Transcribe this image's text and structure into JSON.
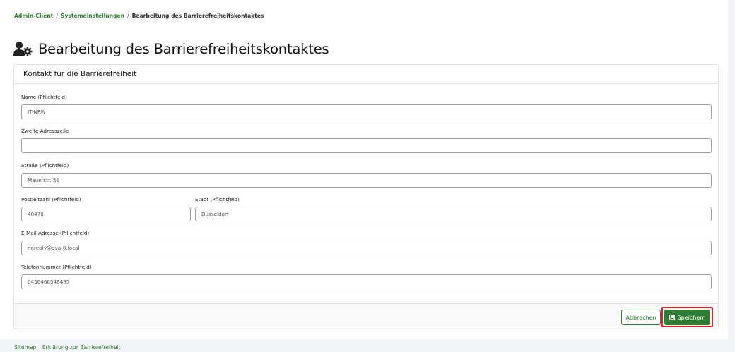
{
  "breadcrumb": {
    "items": [
      "Admin-Client",
      "Systemeinstellungen"
    ],
    "separator": "/",
    "current": "Bearbeitung des Barrierefreiheitskontaktes"
  },
  "page": {
    "title": "Bearbeitung des Barrierefreiheitskontaktes",
    "title_icon": "users-gear-icon"
  },
  "card": {
    "header": "Kontakt für die Barrierefreiheit"
  },
  "form": {
    "name": {
      "label": "Name (Pflichtfeld)",
      "value": "IT-NRW"
    },
    "address2": {
      "label": "Zweite Adresszeile",
      "value": ""
    },
    "street": {
      "label": "Straße (Pflichtfeld)",
      "value": "Mauerstr. 51"
    },
    "postal": {
      "label": "Postleitzahl (Pflichtfeld)",
      "value": "40476"
    },
    "city": {
      "label": "Stadt (Pflichtfeld)",
      "value": "Düsseldorf"
    },
    "email": {
      "label": "E-Mail-Adresse (Pflichtfeld)",
      "value": "noreply@eva-0.local"
    },
    "phone": {
      "label": "Telefonnummer (Pflichtfeld)",
      "value": "0456466546485"
    }
  },
  "actions": {
    "cancel_label": "Abbrechen",
    "save_label": "Speichern",
    "save_icon": "floppy-disk-icon"
  },
  "footer": {
    "links": [
      "Sitemap",
      "Erklärung zur Barrierefreiheit"
    ]
  },
  "colors": {
    "accent": "#2e7d32",
    "highlight": "#e0202a"
  }
}
